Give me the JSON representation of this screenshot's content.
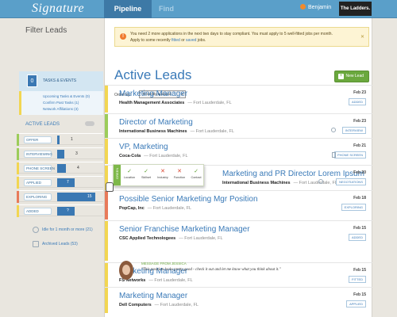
{
  "header": {
    "logo": "Signature",
    "tabs": [
      {
        "label": "Pipeline"
      },
      {
        "label": "Find"
      }
    ],
    "user": "Benjamin",
    "brand": "The Ladders."
  },
  "sidebar": {
    "title": "Filter Leads",
    "tasks": {
      "count": "0",
      "label": "TASKS & EVENTS"
    },
    "links": [
      "Upcoming Tasks & Events (0)",
      "Confirm Past Tasks (1)",
      "Network Affiliations (3)"
    ],
    "active_label": "ACTIVE LEADS",
    "stages": [
      {
        "label": "OFFER",
        "value": "1",
        "fill": 0.05
      },
      {
        "label": "INTERVIEWING",
        "value": "3",
        "fill": 0.18
      },
      {
        "label": "PHONE SCREEN",
        "value": "4",
        "fill": 0.22
      },
      {
        "label": "APPLIED",
        "value": "7",
        "fill": 0.42
      },
      {
        "label": "EXPLORING",
        "value": "15",
        "fill": 0.92
      },
      {
        "label": "ADDED",
        "value": "?",
        "fill": 0.42
      }
    ],
    "stale": "Idle for 1 month or more (21)",
    "archived": "Archived Leads (53)"
  },
  "alert": {
    "line1": "You need 2 more applications in the next two days to stay compliant. You must apply to 5 well-fitted jobs per month.",
    "line2_prefix": "Apply to some recently ",
    "link1": "fitted",
    "mid": " or ",
    "link2": "saved",
    "suffix": " jobs."
  },
  "main": {
    "title": "Active Leads",
    "new_lead": "New Lead",
    "order_label": "Order by:",
    "order_value": "Recently updated"
  },
  "leads": [
    {
      "title": "Marketing Manager",
      "company": "Health Management Associates",
      "location": "Fort Lauderdale, FL",
      "date": "Feb 23",
      "badge": "ADDED",
      "color": "#f2d652"
    },
    {
      "title": "Director of Marketing",
      "company": "International Business Machines",
      "location": "Fort Lauderdale, FL",
      "date": "Feb 23",
      "badge": "INTERVIEW",
      "color": "#9ccc5a"
    },
    {
      "title": "VP, Marketing",
      "company": "Coca-Cola",
      "location": "Fort Lauderdale, FL",
      "date": "Feb 21",
      "badge": "PHONE SCREEN",
      "color": "#f2d652"
    },
    {
      "title": "Marketing and PR Director Lorem Ipsum",
      "company": "International Business Machines",
      "location": "Fort Lauderdale, FL",
      "date": "Feb 20",
      "badge": "NEGOTIATIONS",
      "color": "#f2d652"
    },
    {
      "title": "Possible Senior Marketing Mgr Position",
      "company": "PopCap, Inc",
      "location": "Fort Lauderdale, FL",
      "date": "Feb 18",
      "badge": "EXPLORING",
      "color": "#e87a5a"
    },
    {
      "title": "Senior Franchise Marketing Manager",
      "company": "CSC Applied Technologees",
      "location": "Fort Lauderdale, FL",
      "date": "Feb 15",
      "badge": "ADDED",
      "color": "#f2d652"
    },
    {
      "title": "Marketing Manager",
      "company": "FS Networks",
      "location": "Fort Lauderdale, FL",
      "date": "Feb 15",
      "badge": "FITTED",
      "color": "#f2d652"
    },
    {
      "title": "Marketing Manager",
      "company": "Dell Computers",
      "location": "Fort Lauderdale, FL",
      "date": "Feb 15",
      "badge": "APPLIED",
      "color": "#f2d652"
    }
  ],
  "message": {
    "from": "MESSAGE FROM JESSICA",
    "text": "\"This position looks pretty good - check it out and let me know what you think about it.\""
  },
  "popup": {
    "side": "GREEN",
    "items": [
      {
        "mark": "✓",
        "label": "Location",
        "ok": true
      },
      {
        "mark": "✓",
        "label": "Skillset",
        "ok": true
      },
      {
        "mark": "✕",
        "label": "Industry",
        "ok": false
      },
      {
        "mark": "✕",
        "label": "Function",
        "ok": false
      },
      {
        "mark": "✓",
        "label": "Contact",
        "ok": true
      }
    ]
  }
}
